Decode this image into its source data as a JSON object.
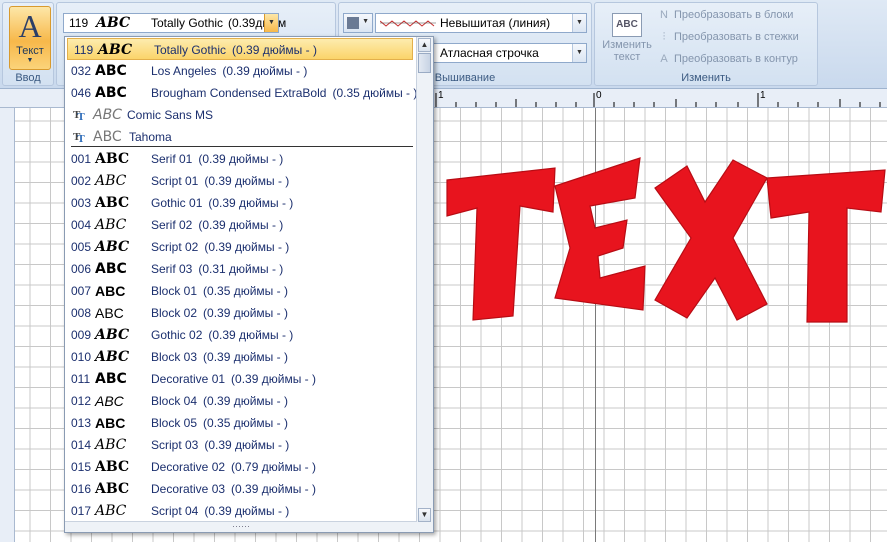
{
  "ribbon": {
    "input_group": {
      "label": "Ввод",
      "text_button": "Текст"
    },
    "font_combo": {
      "number": "119",
      "abc": "ABC",
      "name": "Totally Gothic",
      "size": "(0.39дюйм"
    },
    "stitch_group": {
      "label": "Вышивание",
      "line_type": "Невышитая (линия)",
      "fill_type": "Атласная строчка"
    },
    "modify_group": {
      "label": "Изменить",
      "edit_text_line1": "Изменить",
      "edit_text_line2": "текст",
      "edit_text_icon": "ABC",
      "to_blocks": "Преобразовать в блоки",
      "to_stitches": "Преобразовать в стежки",
      "to_outline": "Преобразовать в контур"
    }
  },
  "rulers": {
    "h_labels": [
      "1",
      "0",
      "1"
    ]
  },
  "font_list": {
    "items": [
      {
        "num": "119",
        "abc": "ABC",
        "name": "Totally Gothic",
        "size": "(0.39 дюймы - )",
        "selected": true
      },
      {
        "num": "032",
        "abc": "ABC",
        "name": "Los Angeles",
        "size": "(0.39 дюймы - )"
      },
      {
        "num": "046",
        "abc": "ABC",
        "name": "Brougham Condensed ExtraBold",
        "size": "(0.35 дюймы - )"
      },
      {
        "num": "",
        "abc": "ABC",
        "name": "Comic Sans MS",
        "size": "",
        "truetype": true
      },
      {
        "num": "",
        "abc": "ABC",
        "name": "Tahoma",
        "size": "",
        "truetype": true
      },
      {
        "num": "001",
        "abc": "ABC",
        "name": "Serif 01",
        "size": "(0.39 дюймы - )"
      },
      {
        "num": "002",
        "abc": "ABC",
        "name": "Script 01",
        "size": "(0.39 дюймы - )"
      },
      {
        "num": "003",
        "abc": "ABC",
        "name": "Gothic 01",
        "size": "(0.39 дюймы - )"
      },
      {
        "num": "004",
        "abc": "ABC",
        "name": "Serif 02",
        "size": "(0.39 дюймы - )"
      },
      {
        "num": "005",
        "abc": "ABC",
        "name": "Script 02",
        "size": "(0.39 дюймы - )"
      },
      {
        "num": "006",
        "abc": "ABC",
        "name": "Serif 03",
        "size": "(0.31 дюймы - )"
      },
      {
        "num": "007",
        "abc": "ABC",
        "name": "Block 01",
        "size": "(0.35 дюймы - )"
      },
      {
        "num": "008",
        "abc": "ABC",
        "name": "Block 02",
        "size": "(0.39 дюймы - )"
      },
      {
        "num": "009",
        "abc": "ABC",
        "name": "Gothic 02",
        "size": "(0.39 дюймы - )"
      },
      {
        "num": "010",
        "abc": "ABC",
        "name": "Block 03",
        "size": "(0.39 дюймы - )"
      },
      {
        "num": "011",
        "abc": "ABC",
        "name": "Decorative 01",
        "size": "(0.39 дюймы - )"
      },
      {
        "num": "012",
        "abc": "ABC",
        "name": "Block 04",
        "size": "(0.39 дюймы - )"
      },
      {
        "num": "013",
        "abc": "ABC",
        "name": "Block 05",
        "size": "(0.35 дюймы - )"
      },
      {
        "num": "014",
        "abc": "ABC",
        "name": "Script 03",
        "size": "(0.39 дюймы - )"
      },
      {
        "num": "015",
        "abc": "ABC",
        "name": "Decorative 02",
        "size": "(0.79 дюймы - )"
      },
      {
        "num": "016",
        "abc": "ABC",
        "name": "Decorative 03",
        "size": "(0.39 дюймы - )"
      },
      {
        "num": "017",
        "abc": "ABC",
        "name": "Script 04",
        "size": "(0.39 дюймы - )"
      }
    ]
  },
  "canvas": {
    "embroidered_text": "TEXT",
    "text_color": "#e8141e"
  },
  "colors": {
    "selection": "#fbd46a",
    "accent": "#f7b84a",
    "ribbon": "#d3e1f1"
  }
}
